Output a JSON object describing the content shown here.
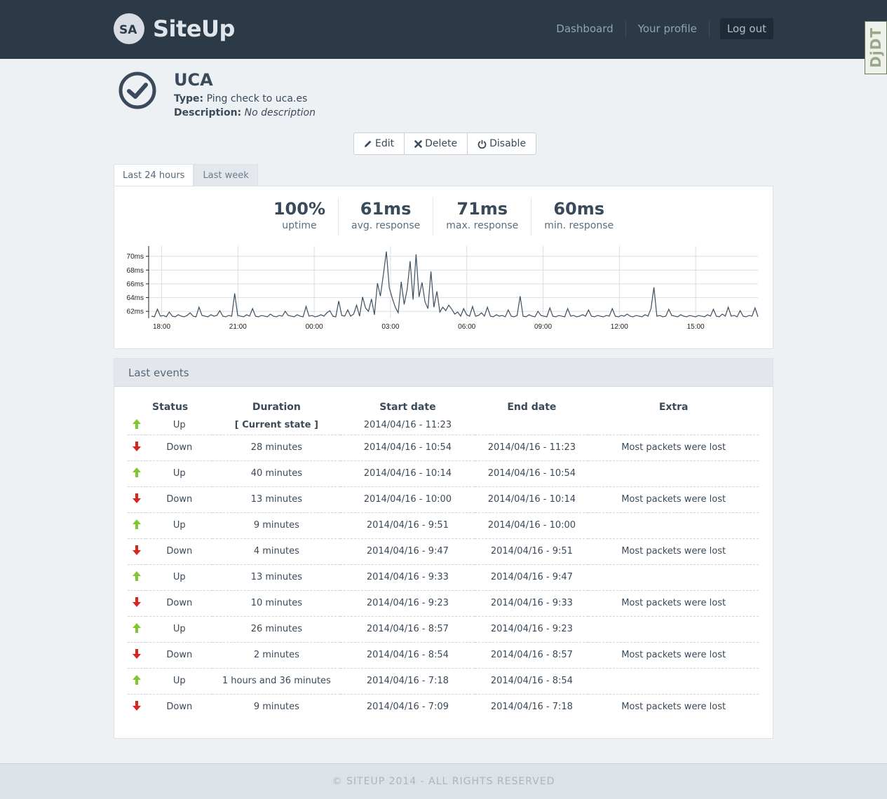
{
  "brand": {
    "name": "SiteUp",
    "logo_text": "SA"
  },
  "nav": {
    "dashboard": "Dashboard",
    "profile": "Your profile",
    "logout": "Log out"
  },
  "debug_toolbar": "DjDT",
  "check": {
    "name": "UCA",
    "status_icon": "check-circle-icon",
    "type_label": "Type:",
    "type_value": "Ping check to uca.es",
    "desc_label": "Description:",
    "desc_value": "No description"
  },
  "actions": {
    "edit": "Edit",
    "delete": "Delete",
    "disable": "Disable"
  },
  "tabs": {
    "day": "Last 24 hours",
    "week": "Last week"
  },
  "stats": [
    {
      "value": "100%",
      "label": "uptime"
    },
    {
      "value": "61ms",
      "label": "avg. response"
    },
    {
      "value": "71ms",
      "label": "max. response"
    },
    {
      "value": "60ms",
      "label": "min. response"
    }
  ],
  "colors": {
    "up": "#7fc832",
    "down": "#d8261e",
    "line": "#3d4e5e",
    "nav": "#2c3a48"
  },
  "chart_data": {
    "type": "line",
    "title": "",
    "xlabel": "",
    "ylabel": "",
    "ylim": [
      61,
      71.5
    ],
    "yticks": [
      "62ms",
      "64ms",
      "66ms",
      "68ms",
      "70ms"
    ],
    "xticks": [
      "18:00",
      "21:00",
      "00:00",
      "03:00",
      "06:00",
      "09:00",
      "12:00",
      "15:00"
    ],
    "grid": true,
    "series": [
      {
        "values": [
          61.3,
          61.2,
          62.3,
          61.3,
          61.4,
          61.2,
          61.9,
          61.3,
          61.2,
          61.5,
          61.3,
          61.2,
          61.4,
          61.8,
          61.3,
          61.2,
          62.6,
          61.4,
          61.3,
          61.2,
          61.5,
          61.3,
          61.4,
          62.1,
          61.3,
          61.2,
          61.4,
          61.3,
          64.6,
          61.4,
          61.3,
          61.2,
          61.5,
          61.3,
          62.4,
          61.3,
          61.2,
          61.4,
          61.3,
          61.2,
          61.6,
          61.3,
          61.2,
          61.4,
          61.3,
          62.0,
          61.4,
          61.3,
          61.2,
          61.5,
          61.3,
          61.2,
          62.7,
          61.3,
          61.4,
          61.2,
          61.3,
          61.5,
          61.3,
          61.8,
          62.1,
          61.3,
          61.2,
          63.5,
          61.4,
          61.3,
          62.2,
          61.3,
          61.6,
          62.9,
          61.3,
          64.1,
          62.5,
          62.0,
          63.8,
          61.5,
          66.1,
          64.2,
          67.3,
          70.7,
          65.4,
          63.9,
          62.6,
          61.8,
          66.3,
          63.0,
          65.2,
          69.3,
          63.7,
          70.3,
          64.1,
          66.2,
          63.4,
          62.4,
          67.8,
          62.6,
          64.9,
          61.9,
          62.6,
          62.1,
          62.9,
          62.3,
          61.6,
          61.9,
          61.3,
          62.4,
          61.5,
          61.3,
          62.7,
          61.3,
          61.4,
          61.8,
          61.3,
          62.6,
          61.3,
          61.2,
          61.5,
          61.3,
          61.4,
          61.2,
          62.2,
          61.3,
          61.2,
          61.4,
          64.2,
          61.3,
          61.2,
          61.5,
          61.3,
          61.2,
          62.0,
          61.4,
          61.3,
          61.2,
          62.5,
          61.3,
          61.2,
          61.4,
          61.3,
          61.2,
          62.4,
          61.3,
          61.4,
          61.2,
          61.3,
          61.5,
          61.3,
          62.2,
          61.3,
          61.2,
          61.4,
          61.3,
          61.2,
          61.4,
          61.3,
          62.4,
          61.3,
          61.2,
          61.4,
          61.3,
          61.6,
          61.3,
          61.2,
          61.4,
          61.3,
          61.2,
          61.5,
          61.3,
          62.4,
          65.5,
          61.3,
          61.4,
          61.2,
          61.3,
          62.3,
          61.4,
          61.3,
          61.2,
          61.5,
          61.3,
          61.2,
          61.4,
          61.3,
          61.2,
          61.4,
          61.3,
          61.2,
          61.5,
          61.3,
          62.3,
          61.3,
          61.2,
          61.6,
          61.3,
          62.6,
          61.3,
          61.4,
          61.2,
          62.1,
          61.3,
          61.2,
          61.4,
          61.3,
          62.5,
          61.2
        ]
      }
    ]
  },
  "events": {
    "title": "Last events",
    "columns": [
      "Status",
      "Duration",
      "Start date",
      "End date",
      "Extra"
    ],
    "rows": [
      {
        "status": "up",
        "label": "Up",
        "duration": "[ Current state ]",
        "start": "2014/04/16 - 11:23",
        "end": "",
        "extra": ""
      },
      {
        "status": "down",
        "label": "Down",
        "duration": "28 minutes",
        "start": "2014/04/16 - 10:54",
        "end": "2014/04/16 - 11:23",
        "extra": "Most packets were lost"
      },
      {
        "status": "up",
        "label": "Up",
        "duration": "40 minutes",
        "start": "2014/04/16 - 10:14",
        "end": "2014/04/16 - 10:54",
        "extra": ""
      },
      {
        "status": "down",
        "label": "Down",
        "duration": "13 minutes",
        "start": "2014/04/16 - 10:00",
        "end": "2014/04/16 - 10:14",
        "extra": "Most packets were lost"
      },
      {
        "status": "up",
        "label": "Up",
        "duration": "9 minutes",
        "start": "2014/04/16 - 9:51",
        "end": "2014/04/16 - 10:00",
        "extra": ""
      },
      {
        "status": "down",
        "label": "Down",
        "duration": "4 minutes",
        "start": "2014/04/16 - 9:47",
        "end": "2014/04/16 - 9:51",
        "extra": "Most packets were lost"
      },
      {
        "status": "up",
        "label": "Up",
        "duration": "13 minutes",
        "start": "2014/04/16 - 9:33",
        "end": "2014/04/16 - 9:47",
        "extra": ""
      },
      {
        "status": "down",
        "label": "Down",
        "duration": "10 minutes",
        "start": "2014/04/16 - 9:23",
        "end": "2014/04/16 - 9:33",
        "extra": "Most packets were lost"
      },
      {
        "status": "up",
        "label": "Up",
        "duration": "26 minutes",
        "start": "2014/04/16 - 8:57",
        "end": "2014/04/16 - 9:23",
        "extra": ""
      },
      {
        "status": "down",
        "label": "Down",
        "duration": "2 minutes",
        "start": "2014/04/16 - 8:54",
        "end": "2014/04/16 - 8:57",
        "extra": "Most packets were lost"
      },
      {
        "status": "up",
        "label": "Up",
        "duration": "1 hours and 36 minutes",
        "start": "2014/04/16 - 7:18",
        "end": "2014/04/16 - 8:54",
        "extra": ""
      },
      {
        "status": "down",
        "label": "Down",
        "duration": "9 minutes",
        "start": "2014/04/16 - 7:09",
        "end": "2014/04/16 - 7:18",
        "extra": "Most packets were lost"
      }
    ]
  },
  "footer": "© SITEUP 2014 - ALL RIGHTS RESERVED"
}
